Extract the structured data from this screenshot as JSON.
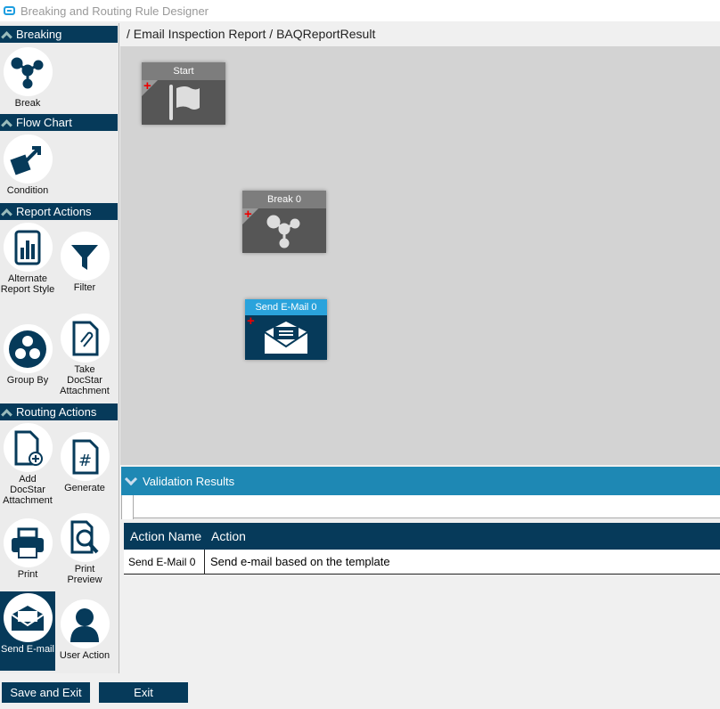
{
  "window": {
    "title": "Breaking and Routing Rule Designer"
  },
  "breadcrumb": "/ Email Inspection Report / BAQReportResult",
  "sidebar": {
    "sections": [
      {
        "label": "Breaking",
        "items": [
          {
            "label": "Break"
          }
        ]
      },
      {
        "label": "Flow Chart",
        "items": [
          {
            "label": "Condition"
          }
        ]
      },
      {
        "label": "Report Actions",
        "items": [
          {
            "label": "Alternate Report Style"
          },
          {
            "label": "Filter"
          },
          {
            "label": "Group By"
          },
          {
            "label": "Take DocStar Attachment"
          }
        ]
      },
      {
        "label": "Routing Actions",
        "items": [
          {
            "label": "Add DocStar Attachment"
          },
          {
            "label": "Generate"
          },
          {
            "label": "Print"
          },
          {
            "label": "Print Preview"
          },
          {
            "label": "Send E-mail"
          },
          {
            "label": "User Action"
          }
        ]
      }
    ]
  },
  "canvas": {
    "nodes": [
      {
        "label": "Start"
      },
      {
        "label": "Break 0"
      },
      {
        "label": "Send E-Mail 0"
      }
    ]
  },
  "validation": {
    "title": "Validation Results",
    "columns": [
      "Action Name",
      "Action"
    ],
    "rows": [
      {
        "name": "Send E-Mail 0",
        "action": "Send e-mail based on the  template"
      }
    ]
  },
  "footer": {
    "save": "Save and Exit",
    "exit": "Exit"
  },
  "colors": {
    "navy": "#063a5a",
    "accent": "#1e88b4",
    "selected_node": "#2aa3dc"
  }
}
